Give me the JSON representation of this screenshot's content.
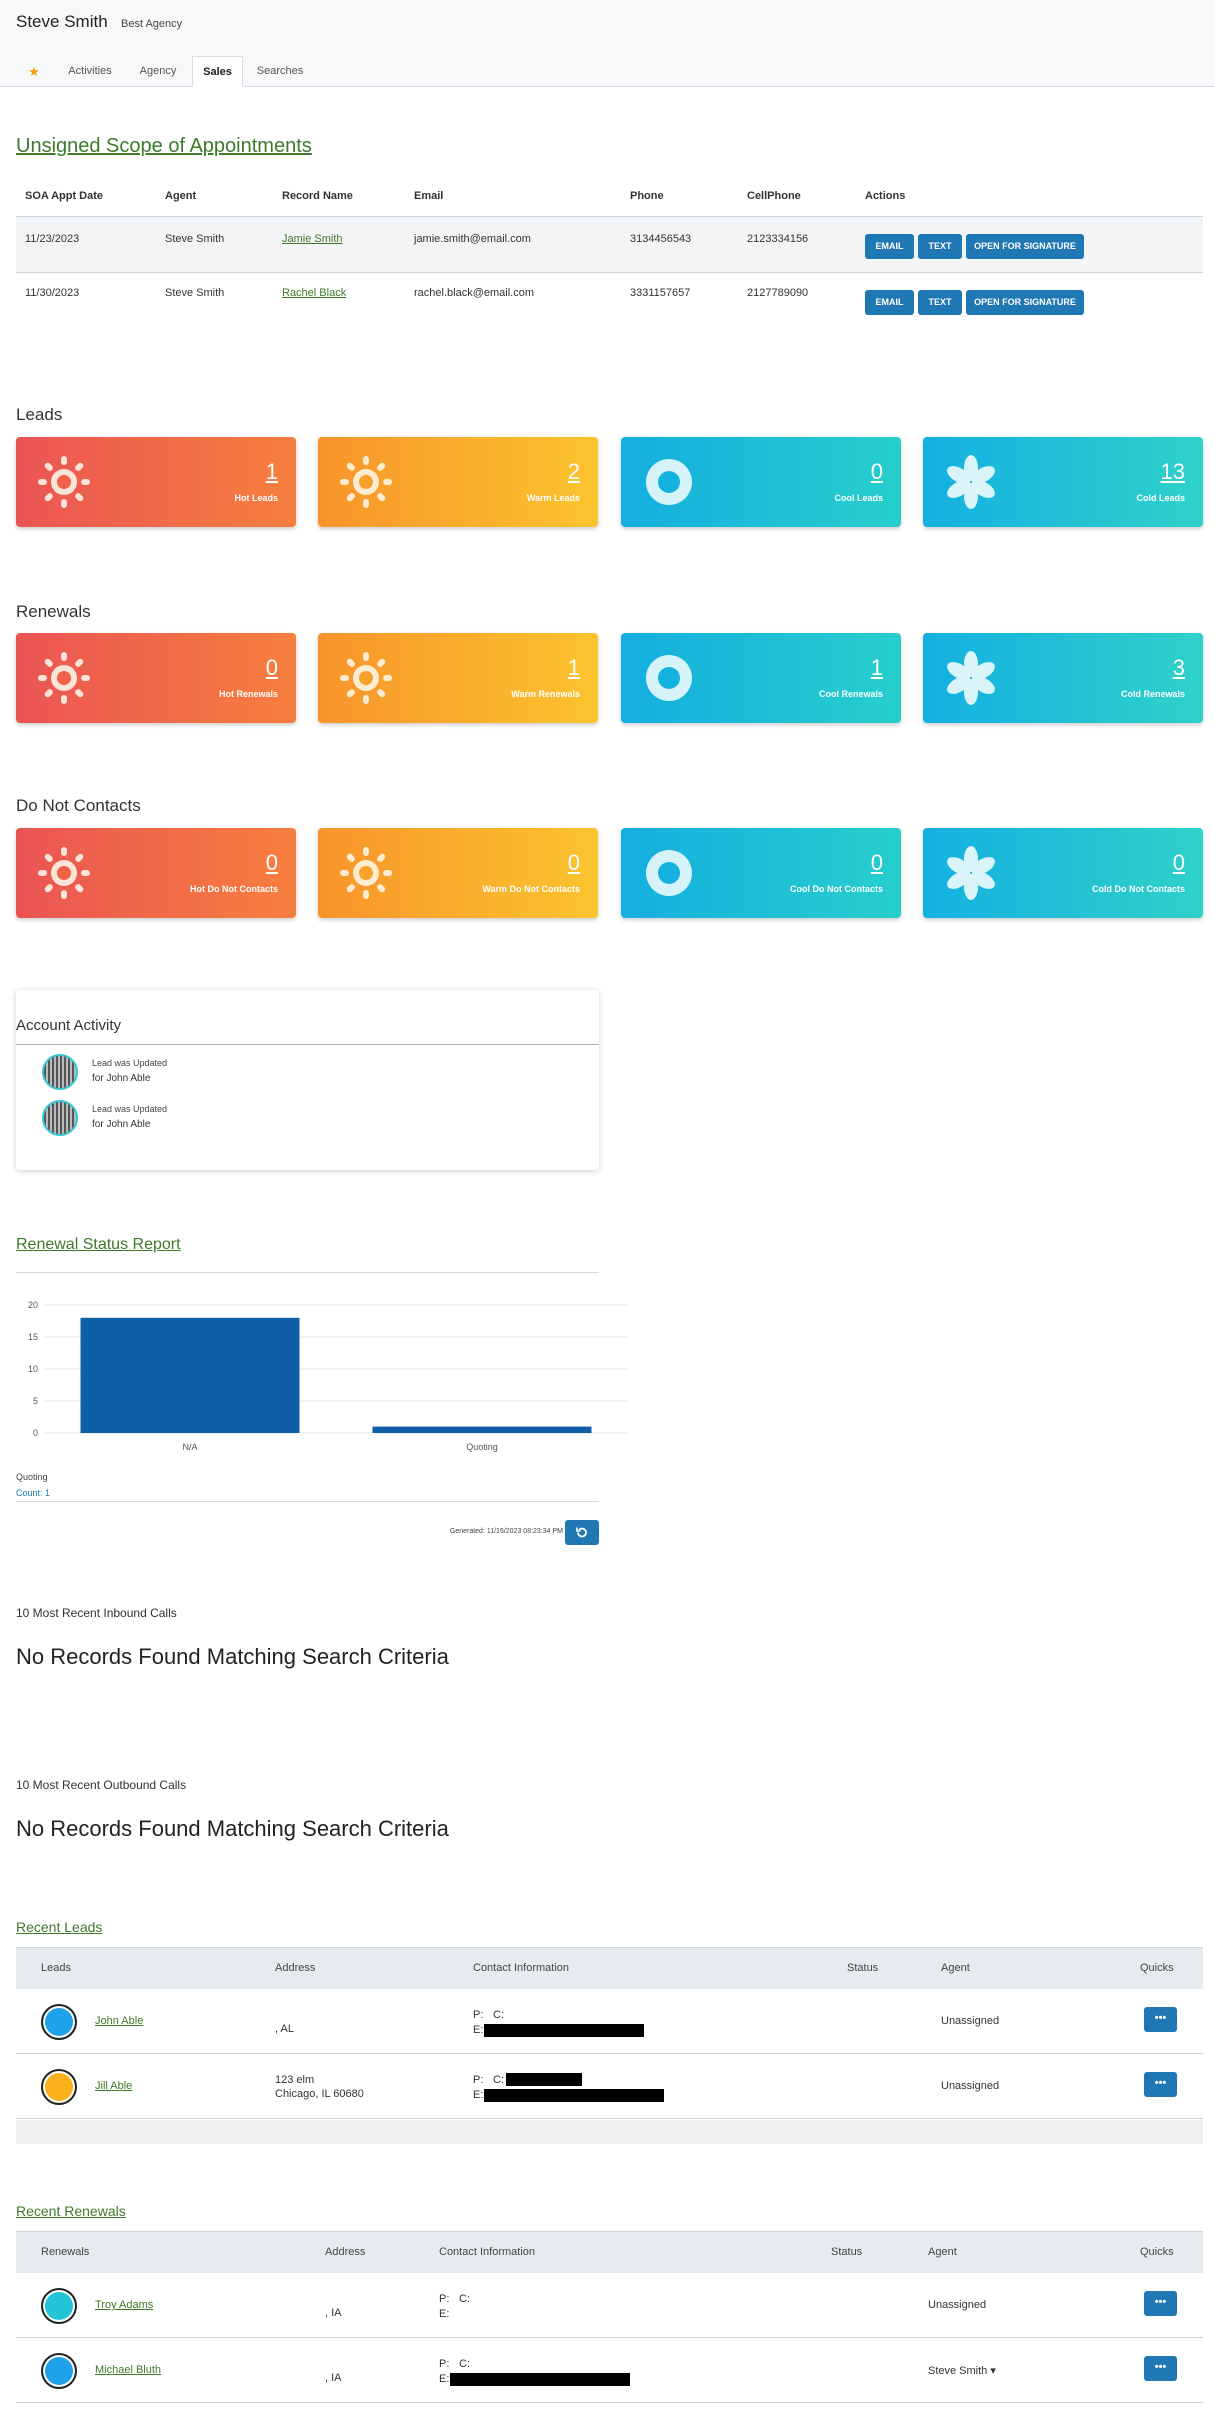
{
  "header": {
    "user_name": "Steve Smith",
    "agency": "Best Agency",
    "tabs": [
      {
        "label": "★",
        "icon": "star-icon"
      },
      {
        "label": "Activities"
      },
      {
        "label": "Agency"
      },
      {
        "label": "Sales",
        "active": true
      },
      {
        "label": "Searches"
      }
    ]
  },
  "soa": {
    "title": "Unsigned Scope of Appointments",
    "columns": [
      "SOA Appt Date",
      "Agent",
      "Record Name",
      "Email",
      "Phone",
      "CellPhone",
      "Actions"
    ],
    "rows": [
      {
        "date": "11/23/2023",
        "agent": "Steve Smith",
        "record": "Jamie Smith",
        "email": "jamie.smith@email.com",
        "phone": "3134456543",
        "cell": "2123334156"
      },
      {
        "date": "11/30/2023",
        "agent": "Steve Smith",
        "record": "Rachel Black",
        "email": "rachel.black@email.com",
        "phone": "3331157657",
        "cell": "2127789090"
      }
    ],
    "actions": {
      "email": "EMAIL",
      "text": "TEXT",
      "sign": "OPEN FOR SIGNATURE"
    }
  },
  "leads": {
    "title": "Leads",
    "cards": [
      {
        "value": "1",
        "label": "Hot Leads"
      },
      {
        "value": "2",
        "label": "Warm Leads"
      },
      {
        "value": "0",
        "label": "Cool Leads"
      },
      {
        "value": "13",
        "label": "Cold Leads"
      }
    ]
  },
  "renewals": {
    "title": "Renewals",
    "cards": [
      {
        "value": "0",
        "label": "Hot Renewals"
      },
      {
        "value": "1",
        "label": "Warm Renewals"
      },
      {
        "value": "1",
        "label": "Cool Renewals"
      },
      {
        "value": "3",
        "label": "Cold Renewals"
      }
    ]
  },
  "dnc": {
    "title": "Do Not Contacts",
    "cards": [
      {
        "value": "0",
        "label": "Hot Do Not Contacts"
      },
      {
        "value": "0",
        "label": "Warm Do Not Contacts"
      },
      {
        "value": "0",
        "label": "Cool Do Not Contacts"
      },
      {
        "value": "0",
        "label": "Cold Do Not Contacts"
      }
    ]
  },
  "colors": {
    "accent": "#1f77b4",
    "link": "#3d7a2a",
    "bar": "#0f5fa8",
    "hot": "#ea5454",
    "warm": "#fbb12e",
    "cool": "#14aee0"
  },
  "activity": {
    "title": "Account Activity",
    "items": [
      {
        "line1": "Lead was Updated",
        "line2": "for John Able"
      },
      {
        "line1": "Lead was Updated",
        "line2": "for John Able"
      }
    ]
  },
  "renewal_report": {
    "title": "Renewal Status Report",
    "legend_label": "Quoting",
    "count_label": "Count: 1",
    "generated": "Generated: 11/16/2023 08:23:34 PM"
  },
  "chart_data": {
    "type": "bar",
    "title": "",
    "categories": [
      "N/A",
      "Quoting"
    ],
    "values": [
      18,
      1
    ],
    "ylim": [
      0,
      20
    ],
    "yticks": [
      0,
      5,
      10,
      15,
      20
    ],
    "grid": true,
    "xlabel": "",
    "ylabel": ""
  },
  "inbound": {
    "title": "10 Most Recent Inbound Calls",
    "empty": "No Records Found Matching Search Criteria"
  },
  "outbound": {
    "title": "10 Most Recent Outbound Calls",
    "empty": "No Records Found Matching Search Criteria"
  },
  "recent_leads": {
    "title": "Recent Leads",
    "columns": [
      "Leads",
      "Address",
      "Contact Information",
      "Status",
      "Agent",
      "Quicks"
    ],
    "rows": [
      {
        "name": "John Able",
        "addr1": "",
        "addr2": ", AL",
        "p": "P:",
        "c": "C:",
        "e": "E:",
        "agent": "Unassigned",
        "dot": "#1da1e8"
      },
      {
        "name": "Jill Able",
        "addr1": "123 elm",
        "addr2": "Chicago, IL 60680",
        "p": "P:",
        "c": "C:",
        "e": "E:",
        "agent": "Unassigned",
        "dot": "#fbb11a"
      }
    ],
    "quick_label": "•••"
  },
  "recent_renewals": {
    "title": "Recent Renewals",
    "columns": [
      "Renewals",
      "Address",
      "Contact Information",
      "Status",
      "Agent",
      "Quicks"
    ],
    "rows": [
      {
        "name": "Troy Adams",
        "addr2": ", IA",
        "p": "P:",
        "c": "C:",
        "e": "E:",
        "agent": "Unassigned",
        "dot": "#22c4d8"
      },
      {
        "name": "Michael Bluth",
        "addr2": ", IA",
        "p": "P:",
        "c": "C:",
        "e": "E:",
        "agent": "Steve Smith ▾",
        "dot": "#1da1e8"
      }
    ],
    "quick_label": "•••"
  }
}
